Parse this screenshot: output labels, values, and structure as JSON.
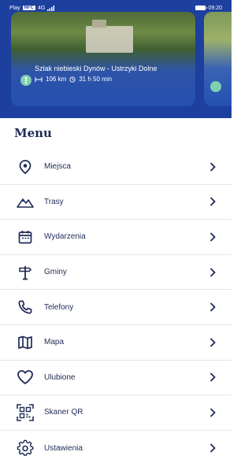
{
  "status_bar": {
    "left_text": "Play",
    "left_tag": "NFC",
    "signal": "4G",
    "time": "09:20"
  },
  "hero": {
    "route_title": "Szlak niebieski Dynów - Ustrzyki Dolne",
    "distance": "106 km",
    "duration": "31 h 50 min"
  },
  "menu": {
    "title": "Menu",
    "items": [
      {
        "label": "Miejsca",
        "icon": "location-pin-icon"
      },
      {
        "label": "Trasy",
        "icon": "mountain-icon"
      },
      {
        "label": "Wydarzenia",
        "icon": "calendar-icon"
      },
      {
        "label": "Gminy",
        "icon": "signpost-icon"
      },
      {
        "label": "Telefony",
        "icon": "phone-icon"
      },
      {
        "label": "Mapa",
        "icon": "map-icon"
      },
      {
        "label": "Ulubione",
        "icon": "heart-icon"
      },
      {
        "label": "Skaner QR",
        "icon": "qr-code-icon"
      },
      {
        "label": "Ustawienia",
        "icon": "gear-icon"
      }
    ]
  },
  "colors": {
    "primary": "#1d3f9e",
    "text": "#1f2a55",
    "accent_pin": "#7fd0b0"
  }
}
